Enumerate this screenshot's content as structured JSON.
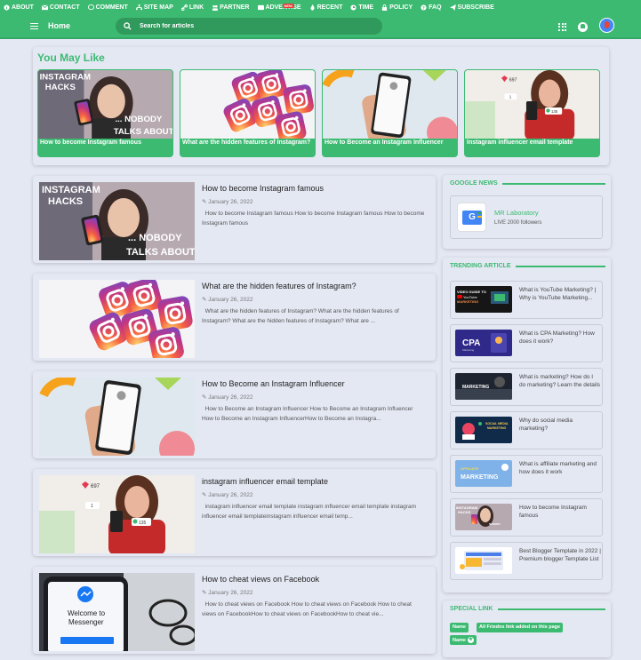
{
  "topnav": {
    "items": [
      {
        "label": "ABOUT",
        "icon": "info-icon"
      },
      {
        "label": "CONTACT",
        "icon": "mail-icon"
      },
      {
        "label": "COMMENT",
        "icon": "comment-icon"
      },
      {
        "label": "SITE MAP",
        "icon": "sitemap-icon"
      },
      {
        "label": "LINK",
        "icon": "link-icon"
      },
      {
        "label": "PARTNER",
        "icon": "users-icon"
      },
      {
        "label": "ADVERTISE",
        "icon": "ad-icon"
      },
      {
        "label": "RECENT",
        "icon": "fire-icon"
      },
      {
        "label": "TIME",
        "icon": "clock-icon"
      },
      {
        "label": "POLICY",
        "icon": "lock-icon"
      },
      {
        "label": "FAQ",
        "icon": "question-icon"
      },
      {
        "label": "SUBSCRIBE",
        "icon": "send-icon"
      }
    ],
    "new_badge": "NEW"
  },
  "header": {
    "home": "Home",
    "search_placeholder": "Search for articles"
  },
  "you_may_like": {
    "title": "You May Like",
    "items": [
      {
        "caption": "How to become Instagram famous",
        "thumb": "insta-hacks"
      },
      {
        "caption": "What are the hidden features of Instagram?",
        "thumb": "insta-logos"
      },
      {
        "caption": "How to Become an Instagram Influencer",
        "thumb": "phone-hand"
      },
      {
        "caption": "Instagram influencer email template",
        "thumb": "girl-phone"
      }
    ]
  },
  "posts": [
    {
      "title": "How to become Instagram famous",
      "date": "January 26, 2022",
      "excerpt": "How to become Instagram famous How to become Instagram famous How to become Instagram famous",
      "thumb": "insta-hacks"
    },
    {
      "title": "What are the hidden features of Instagram?",
      "date": "January 26, 2022",
      "excerpt": "What are the hidden features of Instagram? What are the hidden features of Instagram? What are the hidden features of Instagram? What are ...",
      "thumb": "insta-logos"
    },
    {
      "title": "How to Become an Instagram Influencer",
      "date": "January 26, 2022",
      "excerpt": "How to Become an Instagram Influencer How to Become an Instagram Influencer How to Become an Instagram InfluencerHow to Become an Instagra...",
      "thumb": "phone-hand"
    },
    {
      "title": "instagram influencer email template",
      "date": "January 26, 2022",
      "excerpt": "instagram influencer email template instagram influencer email template instagram influencer email templateinstagram influencer email temp...",
      "thumb": "girl-phone"
    },
    {
      "title": "How to cheat views on Facebook",
      "date": "January 26, 2022",
      "excerpt": "How to cheat views on Facebook How to cheat views on Facebook How to cheat views on FacebookHow to cheat views on FacebookHow to cheat vie...",
      "thumb": "messenger"
    }
  ],
  "insta_hacks": {
    "line1": "INSTAGRAM",
    "line2": "HACKS",
    "line3": "... NOBODY",
    "line4": "TALKS ABOUT"
  },
  "insta_stats": {
    "likes": "697",
    "users": "1",
    "comments": "135"
  },
  "messenger_text": {
    "welcome": "Welcome to",
    "app": "Messenger"
  },
  "google_news": {
    "title": "GOOGLE NEWS",
    "name": "MR Laboratory",
    "followers": "LIVE 2000 followers",
    "logo_text": "G"
  },
  "trending": {
    "title": "TRENDING ARTICLE",
    "items": [
      {
        "title": "What is YouTube Marketing? | Why is YouTube Marketing...",
        "thumb_text": "VIDEO GUIDE TO YouTube MARKETING",
        "thumb": "yt"
      },
      {
        "title": "What is CPA Marketing? How does it work?",
        "thumb_text": "CPA",
        "thumb": "cpa"
      },
      {
        "title": "What is marketing? How do I do marketing? Learn the details",
        "thumb_text": "MARKETING",
        "thumb": "mk"
      },
      {
        "title": "Why do social media marketing?",
        "thumb_text": "SOCIAL MEDIA MARKETING",
        "thumb": "sm"
      },
      {
        "title": "What is affiliate marketing and how does it work",
        "thumb_text": "AFFILIATE MARKETING",
        "thumb": "af"
      },
      {
        "title": "How to become Instagram famous",
        "thumb_text": "INSTAGRAM HACKS",
        "thumb": "ih"
      },
      {
        "title": "Best Blogger Template in 2022 | Premium blogger Template List",
        "thumb_text": "",
        "thumb": "bt"
      }
    ]
  },
  "special_link": {
    "title": "SPECIAL LINK",
    "tags": [
      "Name",
      "All Friedns link added on this page",
      "Name"
    ]
  },
  "colors": {
    "accent": "#3dba72",
    "background": "#e4e8f3",
    "new_badge": "#e53935"
  }
}
